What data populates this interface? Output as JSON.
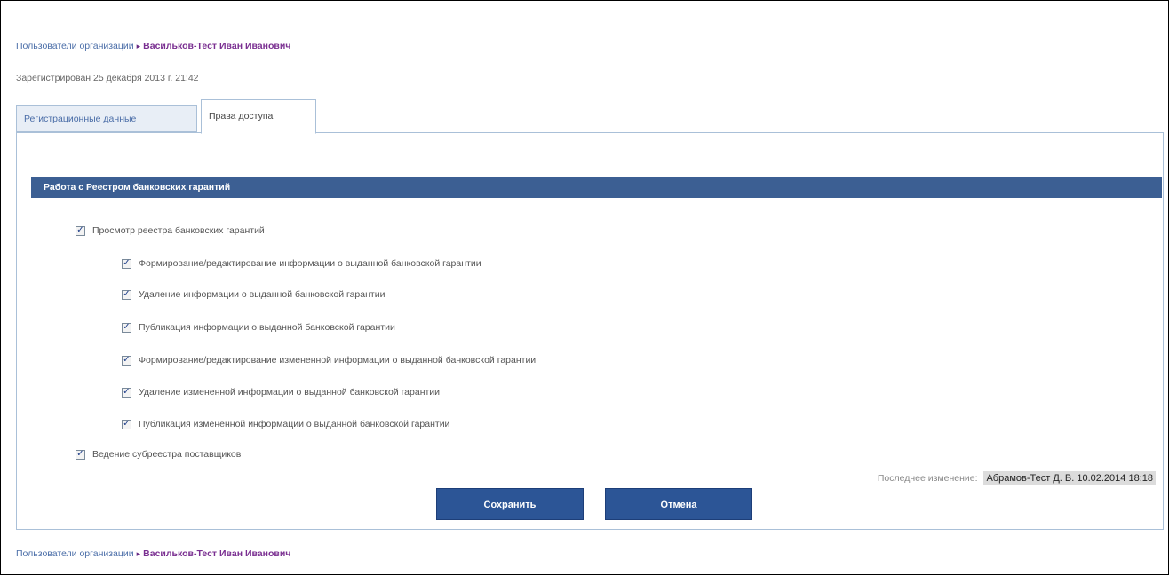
{
  "breadcrumb": {
    "parent": "Пользователи организации",
    "separator": "▸",
    "current": "Васильков-Тест Иван Иванович"
  },
  "registered": "Зарегистрирован 25 декабря 2013 г. 21:42",
  "tabs": [
    {
      "label": "Регистрационные данные",
      "active": false
    },
    {
      "label": "Права доступа",
      "active": true
    }
  ],
  "section": {
    "title": "Работа с Реестром банковских гарантий"
  },
  "permissions": [
    {
      "label": "Просмотр реестра банковских гарантий",
      "checked": true,
      "level": 0
    },
    {
      "label": "Формирование/редактирование информации о выданной банковской гарантии",
      "checked": true,
      "level": 1
    },
    {
      "label": "Удаление информации о выданной банковской гарантии",
      "checked": true,
      "level": 1
    },
    {
      "label": "Публикация информации о выданной банковской гарантии",
      "checked": true,
      "level": 1
    },
    {
      "label": "Формирование/редактирование измененной информации о выданной банковской гарантии",
      "checked": true,
      "level": 1
    },
    {
      "label": "Удаление измененной информации о выданной банковской гарантии",
      "checked": true,
      "level": 1
    },
    {
      "label": "Публикация измененной информации о выданной банковской гарантии",
      "checked": true,
      "level": 1
    },
    {
      "label": "Ведение субреестра поставщиков",
      "checked": true,
      "level": 0
    }
  ],
  "last_change": {
    "label": "Последнее изменение:",
    "value": "Абрамов-Тест Д. В. 10.02.2014 18:18"
  },
  "buttons": {
    "save": "Сохранить",
    "cancel": "Отмена"
  },
  "icons": {
    "checkbox_checked": "checkbox-checked-icon",
    "breadcrumb_separator": "triangle-right-icon"
  }
}
